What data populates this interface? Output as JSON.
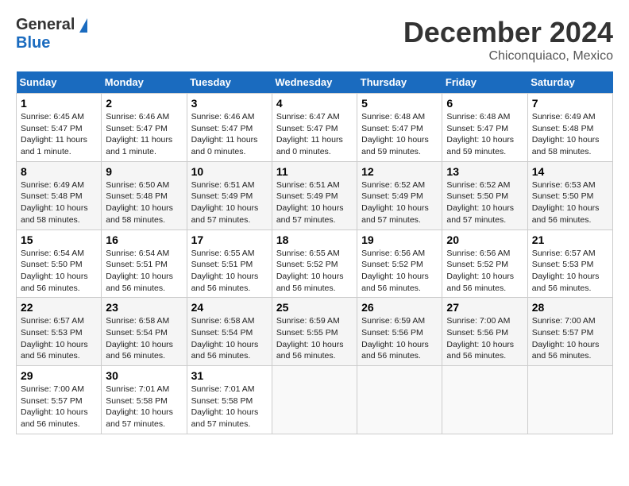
{
  "logo": {
    "general": "General",
    "blue": "Blue"
  },
  "title": "December 2024",
  "subtitle": "Chiconquiaco, Mexico",
  "headers": [
    "Sunday",
    "Monday",
    "Tuesday",
    "Wednesday",
    "Thursday",
    "Friday",
    "Saturday"
  ],
  "weeks": [
    [
      {
        "day": "1",
        "sunrise": "6:45 AM",
        "sunset": "5:47 PM",
        "daylight": "11 hours and 1 minute."
      },
      {
        "day": "2",
        "sunrise": "6:46 AM",
        "sunset": "5:47 PM",
        "daylight": "11 hours and 1 minute."
      },
      {
        "day": "3",
        "sunrise": "6:46 AM",
        "sunset": "5:47 PM",
        "daylight": "11 hours and 0 minutes."
      },
      {
        "day": "4",
        "sunrise": "6:47 AM",
        "sunset": "5:47 PM",
        "daylight": "11 hours and 0 minutes."
      },
      {
        "day": "5",
        "sunrise": "6:48 AM",
        "sunset": "5:47 PM",
        "daylight": "10 hours and 59 minutes."
      },
      {
        "day": "6",
        "sunrise": "6:48 AM",
        "sunset": "5:47 PM",
        "daylight": "10 hours and 59 minutes."
      },
      {
        "day": "7",
        "sunrise": "6:49 AM",
        "sunset": "5:48 PM",
        "daylight": "10 hours and 58 minutes."
      }
    ],
    [
      {
        "day": "8",
        "sunrise": "6:49 AM",
        "sunset": "5:48 PM",
        "daylight": "10 hours and 58 minutes."
      },
      {
        "day": "9",
        "sunrise": "6:50 AM",
        "sunset": "5:48 PM",
        "daylight": "10 hours and 58 minutes."
      },
      {
        "day": "10",
        "sunrise": "6:51 AM",
        "sunset": "5:49 PM",
        "daylight": "10 hours and 57 minutes."
      },
      {
        "day": "11",
        "sunrise": "6:51 AM",
        "sunset": "5:49 PM",
        "daylight": "10 hours and 57 minutes."
      },
      {
        "day": "12",
        "sunrise": "6:52 AM",
        "sunset": "5:49 PM",
        "daylight": "10 hours and 57 minutes."
      },
      {
        "day": "13",
        "sunrise": "6:52 AM",
        "sunset": "5:50 PM",
        "daylight": "10 hours and 57 minutes."
      },
      {
        "day": "14",
        "sunrise": "6:53 AM",
        "sunset": "5:50 PM",
        "daylight": "10 hours and 56 minutes."
      }
    ],
    [
      {
        "day": "15",
        "sunrise": "6:54 AM",
        "sunset": "5:50 PM",
        "daylight": "10 hours and 56 minutes."
      },
      {
        "day": "16",
        "sunrise": "6:54 AM",
        "sunset": "5:51 PM",
        "daylight": "10 hours and 56 minutes."
      },
      {
        "day": "17",
        "sunrise": "6:55 AM",
        "sunset": "5:51 PM",
        "daylight": "10 hours and 56 minutes."
      },
      {
        "day": "18",
        "sunrise": "6:55 AM",
        "sunset": "5:52 PM",
        "daylight": "10 hours and 56 minutes."
      },
      {
        "day": "19",
        "sunrise": "6:56 AM",
        "sunset": "5:52 PM",
        "daylight": "10 hours and 56 minutes."
      },
      {
        "day": "20",
        "sunrise": "6:56 AM",
        "sunset": "5:52 PM",
        "daylight": "10 hours and 56 minutes."
      },
      {
        "day": "21",
        "sunrise": "6:57 AM",
        "sunset": "5:53 PM",
        "daylight": "10 hours and 56 minutes."
      }
    ],
    [
      {
        "day": "22",
        "sunrise": "6:57 AM",
        "sunset": "5:53 PM",
        "daylight": "10 hours and 56 minutes."
      },
      {
        "day": "23",
        "sunrise": "6:58 AM",
        "sunset": "5:54 PM",
        "daylight": "10 hours and 56 minutes."
      },
      {
        "day": "24",
        "sunrise": "6:58 AM",
        "sunset": "5:54 PM",
        "daylight": "10 hours and 56 minutes."
      },
      {
        "day": "25",
        "sunrise": "6:59 AM",
        "sunset": "5:55 PM",
        "daylight": "10 hours and 56 minutes."
      },
      {
        "day": "26",
        "sunrise": "6:59 AM",
        "sunset": "5:56 PM",
        "daylight": "10 hours and 56 minutes."
      },
      {
        "day": "27",
        "sunrise": "7:00 AM",
        "sunset": "5:56 PM",
        "daylight": "10 hours and 56 minutes."
      },
      {
        "day": "28",
        "sunrise": "7:00 AM",
        "sunset": "5:57 PM",
        "daylight": "10 hours and 56 minutes."
      }
    ],
    [
      {
        "day": "29",
        "sunrise": "7:00 AM",
        "sunset": "5:57 PM",
        "daylight": "10 hours and 56 minutes."
      },
      {
        "day": "30",
        "sunrise": "7:01 AM",
        "sunset": "5:58 PM",
        "daylight": "10 hours and 57 minutes."
      },
      {
        "day": "31",
        "sunrise": "7:01 AM",
        "sunset": "5:58 PM",
        "daylight": "10 hours and 57 minutes."
      },
      null,
      null,
      null,
      null
    ]
  ],
  "labels": {
    "sunrise": "Sunrise:",
    "sunset": "Sunset:",
    "daylight": "Daylight:"
  }
}
